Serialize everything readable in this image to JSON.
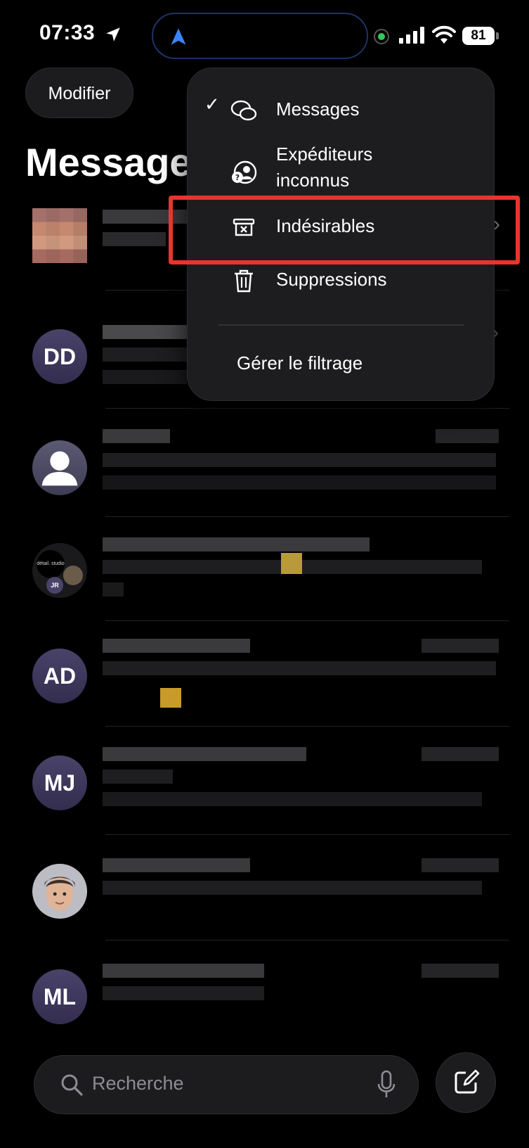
{
  "status_bar": {
    "time": "07:33",
    "battery": "81",
    "icons": [
      "location-arrow-icon",
      "navigation-icon",
      "signal-icon",
      "wifi-icon",
      "battery-icon"
    ]
  },
  "header": {
    "edit_button": "Modifier",
    "title": "Messages"
  },
  "menu": {
    "items": [
      {
        "label": "Messages",
        "icon": "chat-bubbles-icon",
        "checked": true
      },
      {
        "label": "Expéditeurs inconnus",
        "icon": "unknown-senders-icon",
        "checked": false
      },
      {
        "label": "Indésirables",
        "icon": "junk-box-icon",
        "checked": false,
        "highlighted": true
      },
      {
        "label": "Suppressions",
        "icon": "trash-icon",
        "checked": false
      }
    ],
    "manage_filtering": "Gérer le filtrage"
  },
  "conversations": [
    {
      "avatar_type": "photo",
      "initials": ""
    },
    {
      "avatar_type": "initials",
      "initials": "DD"
    },
    {
      "avatar_type": "person",
      "initials": ""
    },
    {
      "avatar_type": "group",
      "initials": "JR",
      "group_label": "détail. studio"
    },
    {
      "avatar_type": "initials",
      "initials": "AD"
    },
    {
      "avatar_type": "initials",
      "initials": "MJ"
    },
    {
      "avatar_type": "memoji",
      "initials": ""
    },
    {
      "avatar_type": "initials",
      "initials": "ML"
    }
  ],
  "bottom_bar": {
    "search_placeholder": "Recherche",
    "compose_icon": "compose-icon",
    "mic_icon": "microphone-icon"
  },
  "colors": {
    "background": "#000000",
    "menu_background": "#1d1d1f",
    "highlight": "#e8352a",
    "avatar": "#3f3860"
  }
}
